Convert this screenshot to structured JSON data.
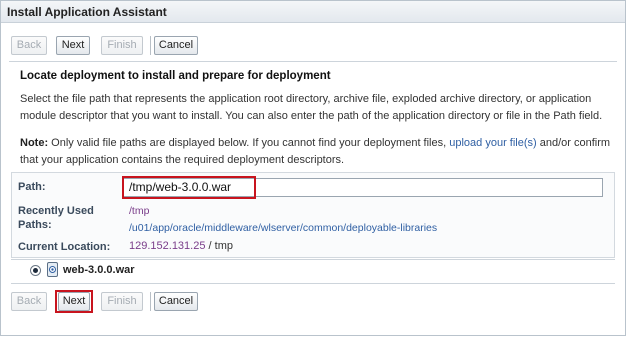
{
  "window": {
    "title": "Install Application Assistant"
  },
  "toolbar": {
    "back_label": "Back",
    "next_label": "Next",
    "finish_label": "Finish",
    "cancel_label": "Cancel"
  },
  "section": {
    "heading": "Locate deployment to install and prepare for deployment",
    "description": "Select the file path that represents the application root directory, archive file, exploded archive directory, or application module descriptor that you want to install. You can also enter the path of the application directory or file in the Path field.",
    "note_label": "Note:",
    "note_text_1": "Only valid file paths are displayed below. If you cannot find your deployment files,",
    "note_link": "upload your file(s)",
    "note_text_2": "and/or confirm that your application contains the required deployment descriptors."
  },
  "form": {
    "path_label": "Path:",
    "path_value": "/tmp/web-3.0.0.war",
    "recent_label": "Recently Used Paths:",
    "recent_paths": [
      "/tmp",
      "/u01/app/oracle/middleware/wlserver/common/deployable-libraries"
    ],
    "current_location_label": "Current Location:",
    "current_location_host": "129.152.131.25",
    "current_location_sep": "/",
    "current_location_dir": "tmp"
  },
  "file_list": [
    {
      "name": "web-3.0.0.war",
      "selected": true,
      "icon": "war-file-icon"
    }
  ],
  "colors": {
    "highlight": "#c8141e",
    "link": "#2f5fa3",
    "visited_link": "#7a3d8a"
  }
}
